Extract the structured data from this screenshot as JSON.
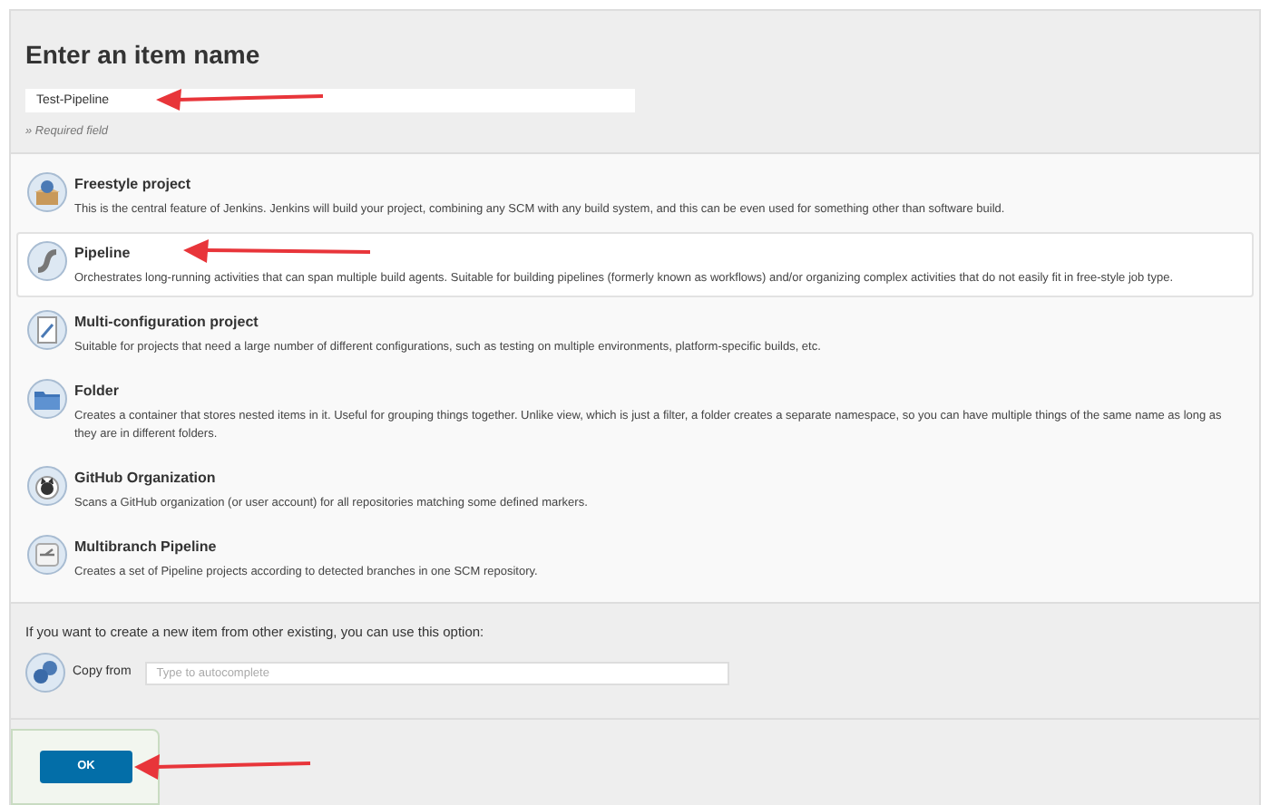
{
  "heading": "Enter an item name",
  "name_field": {
    "value": "Test-Pipeline"
  },
  "required_note": "» Required field",
  "item_types": [
    {
      "kind": "freestyle",
      "name": "Freestyle project",
      "description": "This is the central feature of Jenkins. Jenkins will build your project, combining any SCM with any build system, and this can be even used for something other than software build.",
      "selected": false
    },
    {
      "kind": "pipeline",
      "name": "Pipeline",
      "description": "Orchestrates long-running activities that can span multiple build agents. Suitable for building pipelines (formerly known as workflows) and/or organizing complex activities that do not easily fit in free-style job type.",
      "selected": true
    },
    {
      "kind": "multiconfig",
      "name": "Multi-configuration project",
      "description": "Suitable for projects that need a large number of different configurations, such as testing on multiple environments, platform-specific builds, etc.",
      "selected": false
    },
    {
      "kind": "folder",
      "name": "Folder",
      "description": "Creates a container that stores nested items in it. Useful for grouping things together. Unlike view, which is just a filter, a folder creates a separate namespace, so you can have multiple things of the same name as long as they are in different folders.",
      "selected": false
    },
    {
      "kind": "github",
      "name": "GitHub Organization",
      "description": "Scans a GitHub organization (or user account) for all repositories matching some defined markers.",
      "selected": false
    },
    {
      "kind": "multibranch",
      "name": "Multibranch Pipeline",
      "description": "Creates a set of Pipeline projects according to detected branches in one SCM repository.",
      "selected": false
    }
  ],
  "copy_section": {
    "hint": "If you want to create a new item from other existing, you can use this option:",
    "label": "Copy from",
    "placeholder": "Type to autocomplete"
  },
  "ok_button": "OK"
}
